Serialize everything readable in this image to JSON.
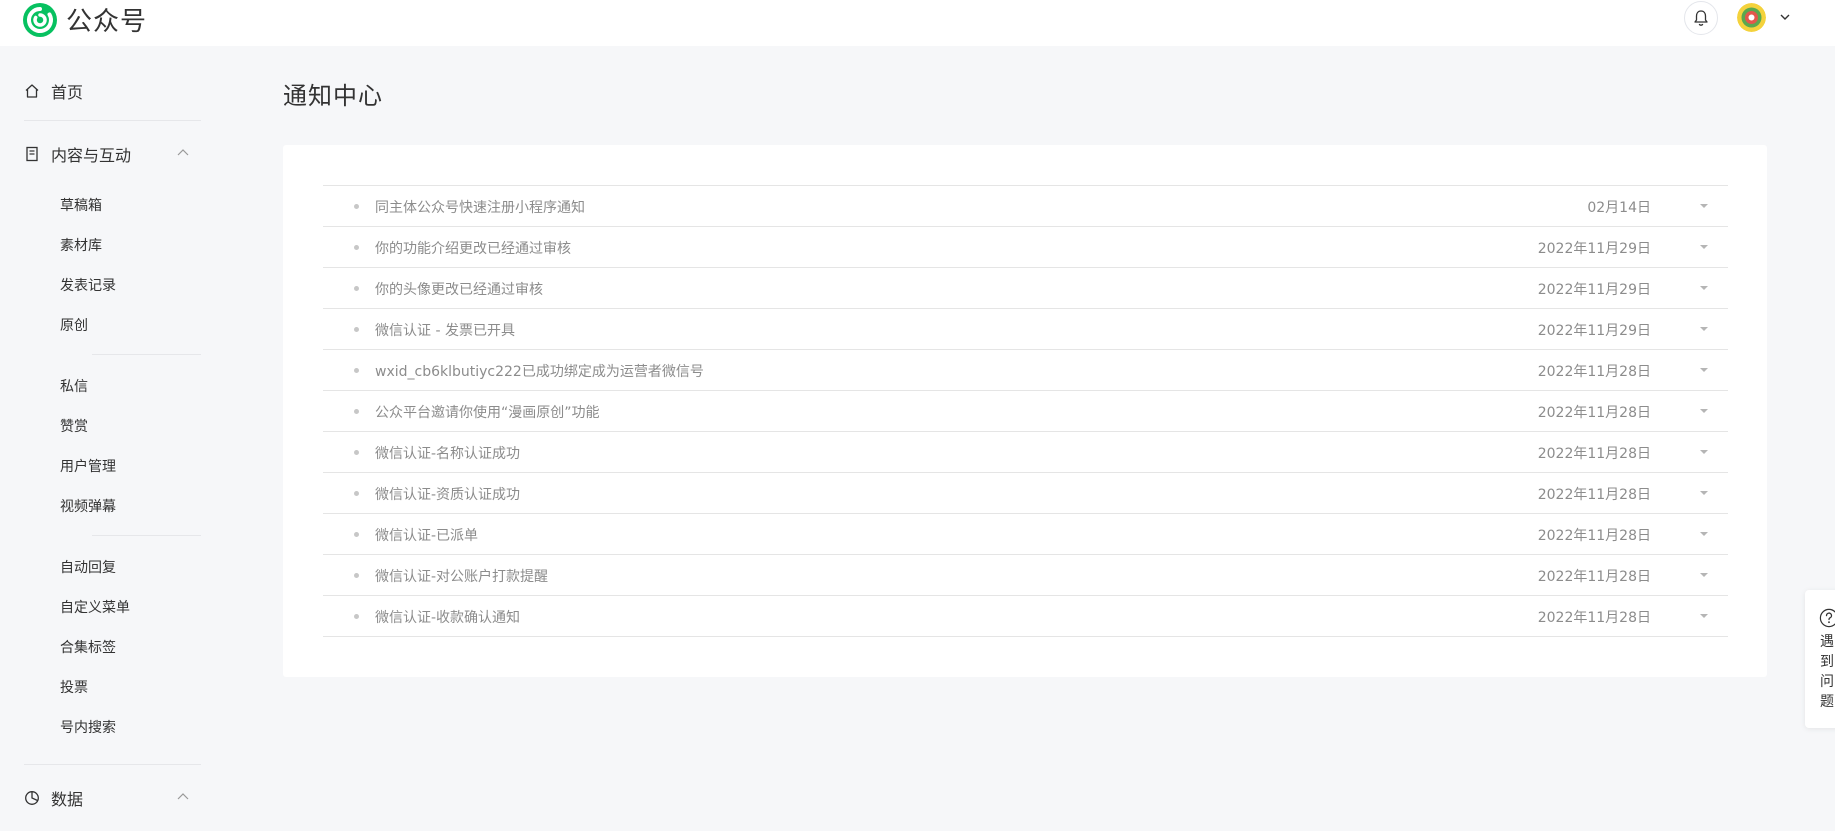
{
  "header": {
    "brand": "公众号"
  },
  "sidebar": {
    "home": "首页",
    "content_section": "内容与互动",
    "content_items": [
      "草稿箱",
      "素材库",
      "发表记录",
      "原创"
    ],
    "interaction_items": [
      "私信",
      "赞赏",
      "用户管理",
      "视频弹幕"
    ],
    "feature_items": [
      "自动回复",
      "自定义菜单",
      "合集标签",
      "投票",
      "号内搜索"
    ],
    "data_section": "数据"
  },
  "main": {
    "title": "通知中心",
    "notices": [
      {
        "title": "同主体公众号快速注册小程序通知",
        "date": "02月14日"
      },
      {
        "title": "你的功能介绍更改已经通过审核",
        "date": "2022年11月29日"
      },
      {
        "title": "你的头像更改已经通过审核",
        "date": "2022年11月29日"
      },
      {
        "title": "微信认证 - 发票已开具",
        "date": "2022年11月29日"
      },
      {
        "title": "wxid_cb6klbutiyc222已成功绑定成为运营者微信号",
        "date": "2022年11月28日"
      },
      {
        "title": "公众平台邀请你使用“漫画原创”功能",
        "date": "2022年11月28日"
      },
      {
        "title": "微信认证-名称认证成功",
        "date": "2022年11月28日"
      },
      {
        "title": "微信认证-资质认证成功",
        "date": "2022年11月28日"
      },
      {
        "title": "微信认证-已派单",
        "date": "2022年11月28日"
      },
      {
        "title": "微信认证-对公账户打款提醒",
        "date": "2022年11月28日"
      },
      {
        "title": "微信认证-收款确认通知",
        "date": "2022年11月28日"
      }
    ]
  },
  "help": {
    "label": "遇到问题"
  },
  "colors": {
    "brand_green": "#07c160",
    "page_bg": "#f6f7f9",
    "muted_text": "#8c8c8c"
  },
  "icons": [
    "wechat-mp-logo-icon",
    "bell-icon",
    "chevron-down-icon",
    "home-icon",
    "document-icon",
    "chevron-up-icon",
    "pie-chart-icon",
    "question-icon"
  ]
}
